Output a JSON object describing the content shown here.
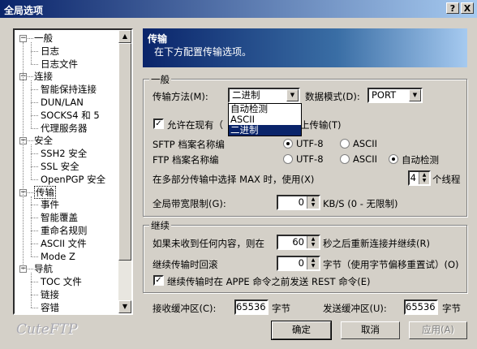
{
  "window": {
    "title": "全局选项",
    "help_btn": "?",
    "close_btn": "X"
  },
  "tree": {
    "items": [
      {
        "label": "一般",
        "level": 0,
        "expanded": true
      },
      {
        "label": "日志",
        "level": 1
      },
      {
        "label": "日志文件",
        "level": 1
      },
      {
        "label": "连接",
        "level": 0,
        "expanded": true
      },
      {
        "label": "智能保持连接",
        "level": 1
      },
      {
        "label": "DUN/LAN",
        "level": 1
      },
      {
        "label": "SOCKS4 和 5",
        "level": 1
      },
      {
        "label": "代理服务器",
        "level": 1
      },
      {
        "label": "安全",
        "level": 0,
        "expanded": true
      },
      {
        "label": "SSH2 安全",
        "level": 1
      },
      {
        "label": "SSL 安全",
        "level": 1
      },
      {
        "label": "OpenPGP 安全",
        "level": 1
      },
      {
        "label": "传输",
        "level": 0,
        "expanded": true,
        "selected": true
      },
      {
        "label": "事件",
        "level": 1
      },
      {
        "label": "智能覆盖",
        "level": 1
      },
      {
        "label": "重命名规则",
        "level": 1
      },
      {
        "label": "ASCII 文件",
        "level": 1
      },
      {
        "label": "Mode Z",
        "level": 1
      },
      {
        "label": "导航",
        "level": 0,
        "expanded": true
      },
      {
        "label": "TOC 文件",
        "level": 1
      },
      {
        "label": "链接",
        "level": 1
      },
      {
        "label": "容错",
        "level": 1
      }
    ]
  },
  "header": {
    "title": "传输",
    "subtitle": "在下方配置传输选项。"
  },
  "general": {
    "group_label": "一般",
    "transfer_method_label": "传输方法(M):",
    "transfer_method_value": "二进制",
    "transfer_method_options": [
      "自动检测",
      "ASCII",
      "二进制"
    ],
    "data_mode_label": "数据模式(D):",
    "data_mode_value": "PORT",
    "allow_resume_label_left": "允许在现有（",
    "allow_resume_label_right": "上传输(T)",
    "sftp_label": "SFTP 档案名称编",
    "ftp_label": "FTP 档案名称编",
    "utf8": "UTF-8",
    "ascii": "ASCII",
    "auto": "自动检测",
    "multipart_label": "在多部分传输中选择 MAX 时，使用(X)",
    "threads_value": "4",
    "threads_unit": "个线程",
    "bandwidth_label": "全局带宽限制(G):",
    "bandwidth_value": "0",
    "bandwidth_unit": "KB/S (0 - 无限制)"
  },
  "resume": {
    "group_label": "继续",
    "no_content_label": "如果未收到任何内容，则在",
    "no_content_value": "60",
    "no_content_unit": "秒之后重新连接并继续(R)",
    "rollback_label": "继续传输时回滚",
    "rollback_value": "0",
    "rollback_unit": "字节（使用字节偏移重置试）(O)",
    "rest_label": "继续传输时在 APPE 命令之前发送 REST 命令(E)"
  },
  "buffers": {
    "recv_label": "接收缓冲区(C):",
    "recv_value": "65536",
    "send_label": "发送缓冲区(U):",
    "send_value": "65536",
    "unit": "字节"
  },
  "buttons": {
    "ok": "确定",
    "cancel": "取消",
    "apply": "应用(A)"
  },
  "brand": "CuteFTP"
}
